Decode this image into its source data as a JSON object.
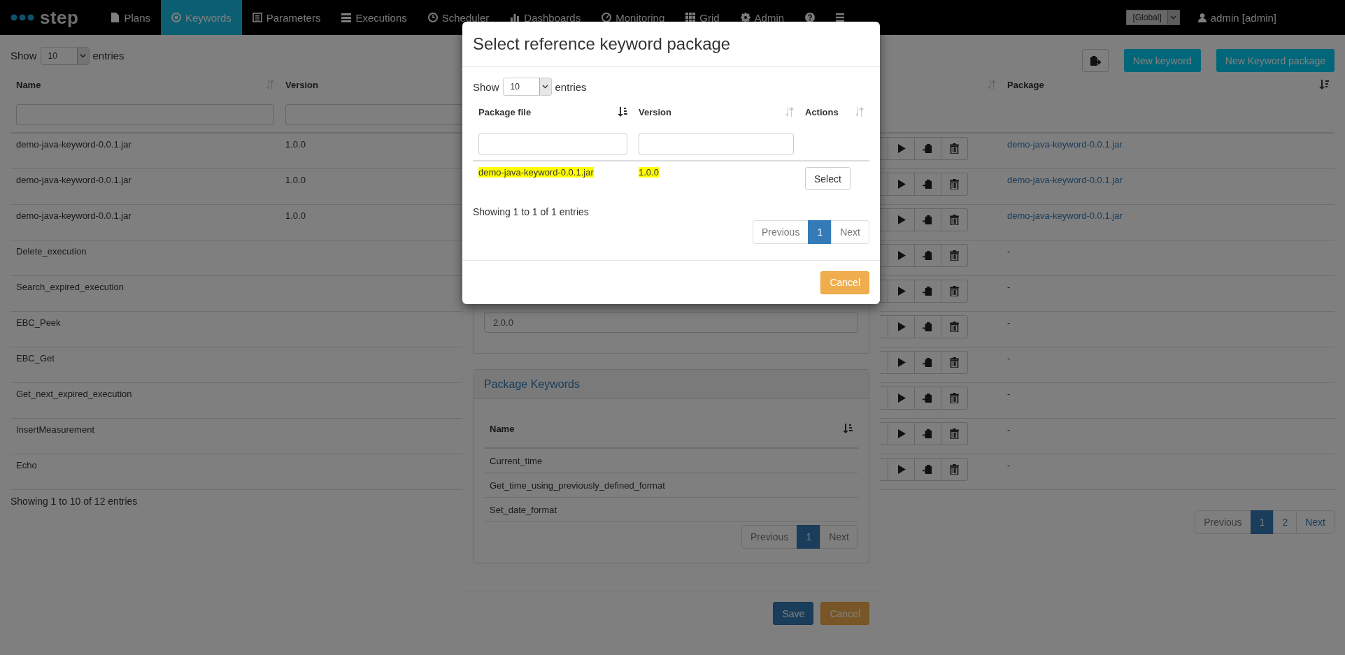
{
  "navbar": {
    "logo": "step",
    "items": [
      {
        "label": "Plans",
        "selected": false
      },
      {
        "label": "Keywords",
        "selected": true
      },
      {
        "label": "Parameters",
        "selected": false
      },
      {
        "label": "Executions",
        "selected": false
      },
      {
        "label": "Scheduler",
        "selected": false
      },
      {
        "label": "Dashboards",
        "selected": false
      },
      {
        "label": "Monitoring",
        "selected": false
      },
      {
        "label": "Grid",
        "selected": false
      },
      {
        "label": "Admin",
        "selected": false
      }
    ],
    "scope_select": "[Global]",
    "user": "admin [admin]"
  },
  "keywords_table": {
    "show_label": "Show",
    "page_length": "10",
    "entries_label": "entries",
    "toolbar_buttons": [
      "New keyword",
      "New Keyword package"
    ],
    "columns": [
      "Name",
      "Version",
      "Package"
    ],
    "rows": [
      {
        "name": "demo-java-keyword-0.0.1.jar",
        "version": "1.0.0",
        "package": {
          "text": "demo-java-keyword-0.0.1.jar",
          "link": true
        }
      },
      {
        "name": "demo-java-keyword-0.0.1.jar",
        "version": "1.0.0",
        "package": {
          "text": "demo-java-keyword-0.0.1.jar",
          "link": true
        }
      },
      {
        "name": "demo-java-keyword-0.0.1.jar",
        "version": "1.0.0",
        "package": {
          "text": "demo-java-keyword-0.0.1.jar",
          "link": true
        }
      },
      {
        "name": "Delete_execution",
        "package": {
          "text": "-",
          "link": false
        }
      },
      {
        "name": "Search_expired_execution",
        "package": {
          "text": "-",
          "link": false
        }
      },
      {
        "name": "EBC_Peek",
        "package": {
          "text": "-",
          "link": false
        }
      },
      {
        "name": "EBC_Get",
        "package": {
          "text": "-",
          "link": false
        }
      },
      {
        "name": "Get_next_expired_execution",
        "package": {
          "text": "-",
          "link": false
        }
      },
      {
        "name": "InsertMeasurement",
        "package": {
          "text": "-",
          "link": false
        }
      },
      {
        "name": "Echo",
        "package": {
          "text": "-",
          "link": false
        }
      }
    ],
    "info": "Showing 1 to 10 of 12 entries",
    "pagination": [
      {
        "label": "Previous",
        "selected": false,
        "disabled": true
      },
      {
        "label": "1",
        "selected": true,
        "disabled": false
      },
      {
        "label": "2",
        "selected": false,
        "disabled": false
      },
      {
        "label": "Next",
        "selected": false,
        "disabled": false
      }
    ]
  },
  "package_dialog": {
    "version_value": "2.0.0",
    "keywords_panel": {
      "title": "Package Keywords",
      "column": "Name",
      "rows": [
        "Current_time",
        "Get_time_using_previously_defined_format",
        "Set_date_format"
      ],
      "pagination": [
        {
          "label": "Previous",
          "selected": false,
          "disabled": true
        },
        {
          "label": "1",
          "selected": true,
          "disabled": false
        },
        {
          "label": "Next",
          "selected": false,
          "disabled": true
        }
      ]
    },
    "buttons": [
      {
        "label": "Save",
        "kind": "primary"
      },
      {
        "label": "Cancel",
        "kind": "warning"
      }
    ]
  },
  "select_dialog": {
    "title": "Select reference keyword package",
    "show_label": "Show",
    "page_length": "10",
    "entries_label": "entries",
    "columns": [
      "Package file",
      "Version",
      "Actions"
    ],
    "rows": [
      {
        "file": "demo-java-keyword-0.0.1.jar",
        "version": "1.0.0",
        "highlighted": true,
        "action": "Select"
      }
    ],
    "info": "Showing 1 to 1 of 1 entries",
    "pagination": [
      {
        "label": "Previous",
        "selected": false,
        "disabled": true
      },
      {
        "label": "1",
        "selected": true,
        "disabled": false
      },
      {
        "label": "Next",
        "selected": false,
        "disabled": true
      }
    ],
    "buttons": [
      {
        "label": "Cancel",
        "kind": "warning"
      }
    ]
  }
}
